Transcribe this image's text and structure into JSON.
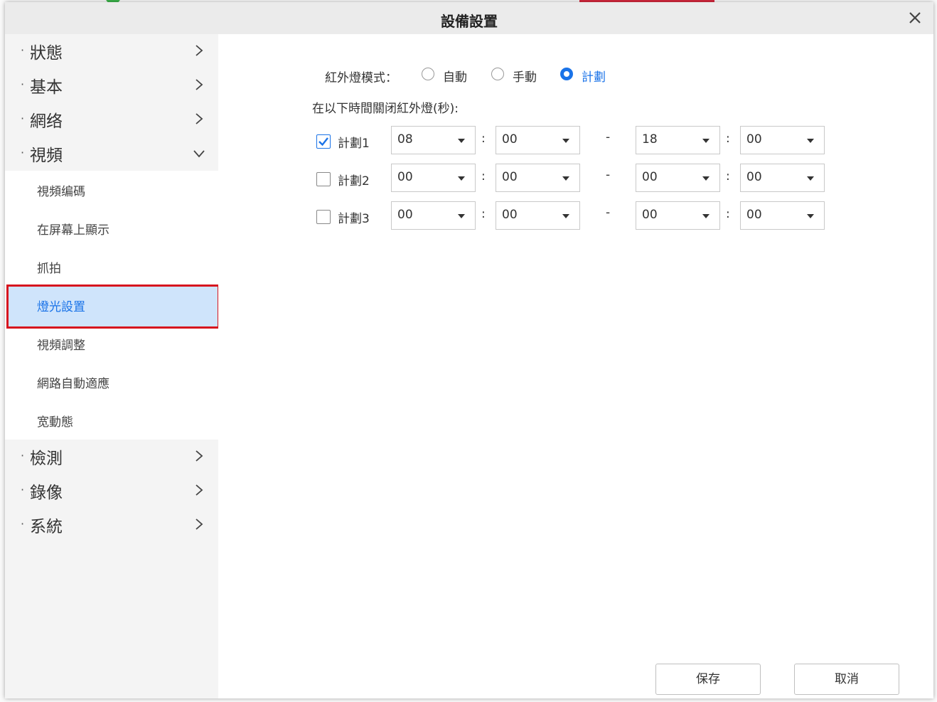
{
  "dialog": {
    "title": "設備設置"
  },
  "sidebar": {
    "items": [
      {
        "label": "狀態"
      },
      {
        "label": "基本"
      },
      {
        "label": "網络"
      },
      {
        "label": "視頻"
      },
      {
        "label": "檢測"
      },
      {
        "label": "錄像"
      },
      {
        "label": "系統"
      }
    ],
    "video_sub": [
      {
        "label": "視頻编碼"
      },
      {
        "label": "在屏幕上顯示"
      },
      {
        "label": "抓拍"
      },
      {
        "label": "燈光設置",
        "active": true
      },
      {
        "label": "視頻調整"
      },
      {
        "label": "網路自動適應"
      },
      {
        "label": "宽動態"
      }
    ]
  },
  "ir": {
    "mode_label": "紅外燈模式：",
    "modes": [
      {
        "label": "自動",
        "selected": false
      },
      {
        "label": "手動",
        "selected": false
      },
      {
        "label": "計劃",
        "selected": true
      }
    ],
    "schedule_label": "在以下時間關闭紅外燈(秒):",
    "schedules": [
      {
        "label": "計劃1",
        "checked": true,
        "start_h": "08",
        "start_m": "00",
        "end_h": "18",
        "end_m": "00"
      },
      {
        "label": "計劃2",
        "checked": false,
        "start_h": "00",
        "start_m": "00",
        "end_h": "00",
        "end_m": "00"
      },
      {
        "label": "計劃3",
        "checked": false,
        "start_h": "00",
        "start_m": "00",
        "end_h": "00",
        "end_m": "00"
      }
    ],
    "colon": ":",
    "dash": "-"
  },
  "buttons": {
    "save": "保存",
    "cancel": "取消"
  },
  "colors": {
    "accent": "#1a73e8",
    "highlight_border": "#d7141e",
    "active_bg": "#cfe4fb"
  }
}
